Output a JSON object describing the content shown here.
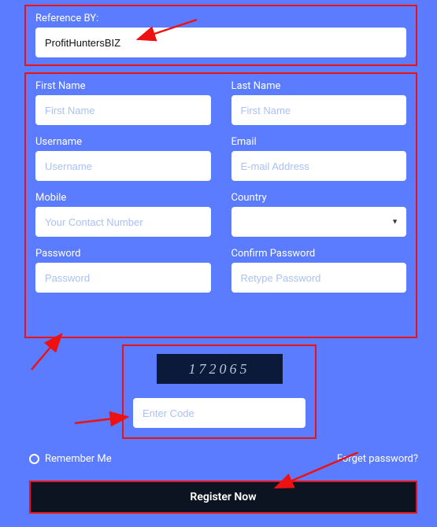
{
  "colors": {
    "background": "#5b7cff",
    "outline": "#e11",
    "placeholder": "#a9c1f5",
    "button_bg": "#0d1421",
    "captcha_bg": "#0b1a3a"
  },
  "reference": {
    "label": "Reference BY:",
    "value": "ProfitHuntersBIZ"
  },
  "fields": {
    "first_name": {
      "label": "First Name",
      "placeholder": "First Name"
    },
    "last_name": {
      "label": "Last Name",
      "placeholder": "First Name"
    },
    "username": {
      "label": "Username",
      "placeholder": "Username"
    },
    "email": {
      "label": "Email",
      "placeholder": "E-mail Address"
    },
    "mobile": {
      "label": "Mobile",
      "placeholder": "Your Contact Number"
    },
    "country": {
      "label": "Country",
      "value": ""
    },
    "password": {
      "label": "Password",
      "placeholder": "Password"
    },
    "confirm_password": {
      "label": "Confirm Password",
      "placeholder": "Retype Password"
    }
  },
  "captcha": {
    "code_display": "172065",
    "placeholder": "Enter Code"
  },
  "remember_me": "Remember Me",
  "forget_password": "Forget password?",
  "register_button": "Register Now"
}
